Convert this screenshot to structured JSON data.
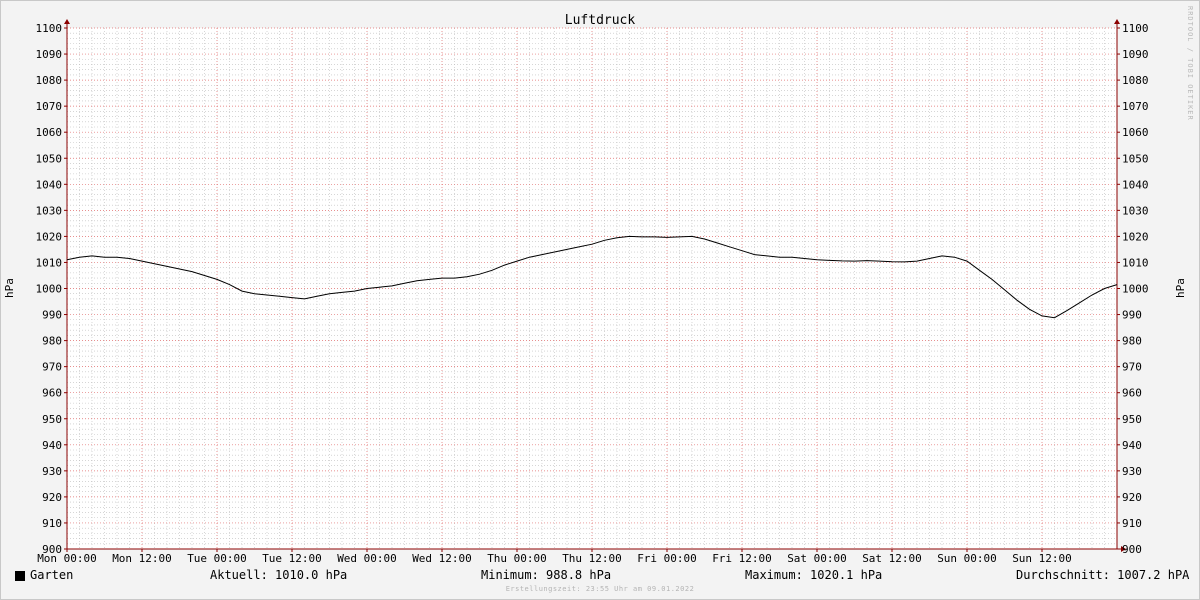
{
  "chart_data": {
    "type": "line",
    "title": "Luftdruck",
    "ylabel": "hPa",
    "ylabel_right": "hPa",
    "ylim": [
      900,
      1100
    ],
    "y_ticks": [
      900,
      910,
      920,
      930,
      940,
      950,
      960,
      970,
      980,
      990,
      1000,
      1010,
      1020,
      1030,
      1040,
      1050,
      1060,
      1070,
      1080,
      1090,
      1100
    ],
    "x_ticks": [
      "Mon 00:00",
      "Mon 12:00",
      "Tue 00:00",
      "Tue 12:00",
      "Wed 00:00",
      "Wed 12:00",
      "Thu 00:00",
      "Thu 12:00",
      "Fri 00:00",
      "Fri 12:00",
      "Sat 00:00",
      "Sat 12:00",
      "Sun 00:00",
      "Sun 12:00"
    ],
    "x_unit": "hours since Mon 00:00",
    "xlim": [
      0,
      168
    ],
    "grid": true,
    "colors": {
      "line": "#000000",
      "grid_major": "#e06a6a",
      "grid_minor": "#bdbdbd",
      "axis": "#8b0000",
      "plot_bg": "#ffffff",
      "page_bg": "#f3f3f3"
    },
    "series": [
      {
        "name": "Garten",
        "x": [
          0,
          2,
          4,
          6,
          8,
          10,
          12,
          14,
          16,
          18,
          20,
          22,
          24,
          26,
          28,
          30,
          32,
          34,
          36,
          38,
          40,
          42,
          44,
          46,
          48,
          50,
          52,
          54,
          56,
          58,
          60,
          62,
          64,
          66,
          68,
          70,
          72,
          74,
          76,
          78,
          80,
          82,
          84,
          86,
          88,
          90,
          92,
          94,
          96,
          98,
          100,
          102,
          104,
          106,
          108,
          110,
          112,
          114,
          116,
          118,
          120,
          122,
          124,
          126,
          128,
          130,
          132,
          134,
          136,
          138,
          140,
          142,
          144,
          146,
          148,
          150,
          152,
          154,
          156,
          158,
          160,
          162,
          164,
          166,
          168
        ],
        "y": [
          1011,
          1012,
          1012.5,
          1012,
          1012,
          1011.5,
          1010.5,
          1009.5,
          1008.5,
          1007.5,
          1006.5,
          1005,
          1003.5,
          1001.5,
          999,
          998,
          997.5,
          997,
          996.5,
          996,
          997,
          998,
          998.5,
          999,
          1000,
          1000.5,
          1001,
          1002,
          1003,
          1003.5,
          1004,
          1004,
          1004.5,
          1005.5,
          1007,
          1009,
          1010.5,
          1012,
          1013,
          1014,
          1015,
          1016,
          1017,
          1018.5,
          1019.5,
          1020,
          1019.8,
          1019.8,
          1019.6,
          1019.8,
          1020,
          1019,
          1017.5,
          1016,
          1014.5,
          1013,
          1012.5,
          1012,
          1012,
          1011.5,
          1011,
          1010.8,
          1010.6,
          1010.5,
          1010.7,
          1010.5,
          1010.3,
          1010.2,
          1010.5,
          1011.5,
          1012.5,
          1012,
          1010.5,
          1007,
          1003.5,
          999.5,
          995.5,
          992,
          989.5,
          988.8,
          991.5,
          994.5,
          997.5,
          1000,
          1001.5
        ]
      }
    ]
  },
  "side_text": "RRDTOOL / TOBI OETIKER",
  "legend": {
    "series_name": "Garten",
    "current": "Aktuell: 1010.0 hPa",
    "minimum": "Minimum: 988.8 hPa",
    "maximum": "Maximum: 1020.1 hPa",
    "average": "Durchschnitt: 1007.2 hPA"
  },
  "footer": "Erstellungszeit: 23:55 Uhr am 09.01.2022"
}
